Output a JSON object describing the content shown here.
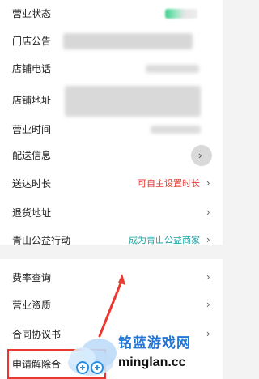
{
  "store_info": {
    "rows": [
      {
        "label": "营业状态"
      },
      {
        "label": "门店公告"
      },
      {
        "label": "店铺电话"
      },
      {
        "label": "店铺地址"
      },
      {
        "label": "营业时间"
      },
      {
        "label": "配送信息"
      },
      {
        "label": "送达时长",
        "value": "可自主设置时长"
      },
      {
        "label": "退货地址"
      },
      {
        "label": "青山公益行动",
        "value": "成为青山公益商家"
      }
    ]
  },
  "contract": {
    "rows": [
      {
        "label": "费率查询"
      },
      {
        "label": "营业资质"
      },
      {
        "label": "合同协议书"
      },
      {
        "label": "申请解除合"
      }
    ]
  },
  "watermark": {
    "cn": "铭蓝游戏网",
    "en": "minglan.cc"
  },
  "colors": {
    "highlight_red": "#e8382f",
    "link_teal": "#1aa3a0",
    "annotation_red": "#e8382f",
    "watermark_blue": "#2376d8"
  },
  "icons": {
    "chevron": "chevron-right-icon",
    "arrow": "pointer-arrow-icon",
    "cloud": "cloud-logo-icon"
  }
}
